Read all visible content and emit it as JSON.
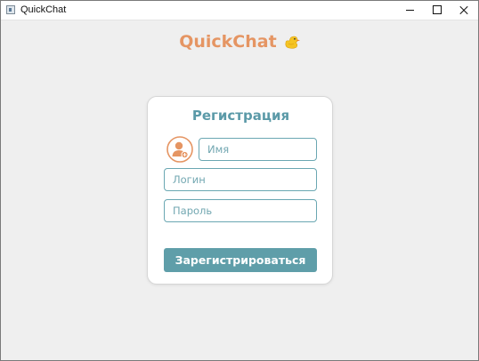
{
  "window": {
    "title": "QuickChat"
  },
  "logo": {
    "text": "QuickChat",
    "icon": "duck-icon"
  },
  "form": {
    "title": "Регистрация",
    "avatar_icon": "add-user-avatar-icon",
    "name_placeholder": "Имя",
    "login_placeholder": "Логин",
    "password_placeholder": "Пароль",
    "submit_label": "Зарегистрироваться"
  },
  "colors": {
    "accent": "#5f9ea9",
    "logo": "#e59563",
    "background": "#efefef"
  }
}
